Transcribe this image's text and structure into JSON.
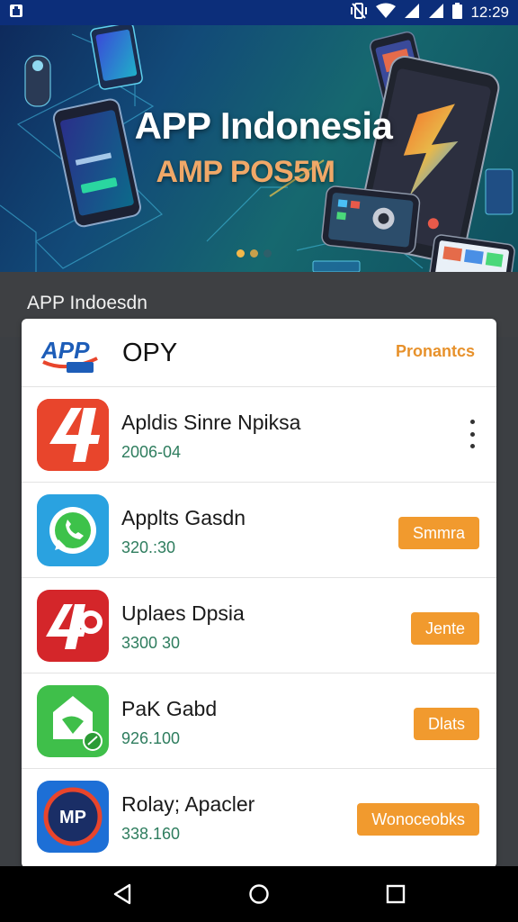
{
  "status_bar": {
    "time": "12:29",
    "icons": [
      "app-notification-icon",
      "vibrate-icon",
      "wifi-icon",
      "signal-icon",
      "signal-icon",
      "battery-icon"
    ]
  },
  "banner": {
    "title": "APP Indonesia",
    "subtitle": "AMP POS5M",
    "active_slide": 1,
    "slide_count": 3
  },
  "section": {
    "title": "APP Indoesdn"
  },
  "card": {
    "logo_text": "APP",
    "title": "OPY",
    "link": "Pronantcs"
  },
  "apps": [
    {
      "name": "Apldis Sinre Npiksa",
      "meta": "2006-04",
      "action": "",
      "icon": "app-4-icon",
      "icon_color": "#e8452c"
    },
    {
      "name": "Applts Gasdn",
      "meta": "320.:30",
      "action": "Smmra",
      "icon": "whatsapp-icon",
      "icon_color": "#2aa2e0"
    },
    {
      "name": "Uplaes Dpsia",
      "meta": "3300 30",
      "action": "Jente",
      "icon": "app-4p-icon",
      "icon_color": "#d4262a"
    },
    {
      "name": "PaK Gabd",
      "meta": "926.100",
      "action": "Dlats",
      "icon": "map-pin-icon",
      "icon_color": "#3fbf4a"
    },
    {
      "name": "Rolay; Apacler",
      "meta": "338.160",
      "action": "Wonoceobks",
      "icon": "mp-icon",
      "icon_color": "#1a2e66"
    }
  ],
  "nav": {
    "icons": [
      "back-icon",
      "home-icon",
      "recents-icon"
    ]
  }
}
